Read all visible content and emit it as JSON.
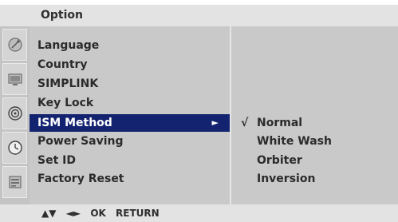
{
  "header": {
    "title": "Option"
  },
  "sidebar": {
    "icons": [
      "satellite-dish-icon",
      "tv-picture-icon",
      "speaker-audio-icon",
      "clock-time-icon",
      "option-panel-icon"
    ],
    "active_index": 4
  },
  "menu": {
    "items": [
      {
        "label": "Language"
      },
      {
        "label": "Country"
      },
      {
        "label": "SIMPLINK"
      },
      {
        "label": "Key Lock"
      },
      {
        "label": "ISM Method",
        "arrow": "►"
      },
      {
        "label": "Power Saving"
      },
      {
        "label": "Set ID"
      },
      {
        "label": "Factory Reset"
      }
    ],
    "selected_index": 4
  },
  "submenu": {
    "check_mark": "√",
    "options": [
      {
        "label": "Normal"
      },
      {
        "label": "White Wash"
      },
      {
        "label": "Orbiter"
      },
      {
        "label": "Inversion"
      }
    ],
    "checked_index": 0
  },
  "footer": {
    "updown": "▲▼",
    "leftright": "◄►",
    "ok": "OK",
    "return": "RETURN"
  },
  "colors": {
    "selection": "#13236f",
    "panel": "#c9c9c9",
    "bar": "#e3e3e3"
  }
}
